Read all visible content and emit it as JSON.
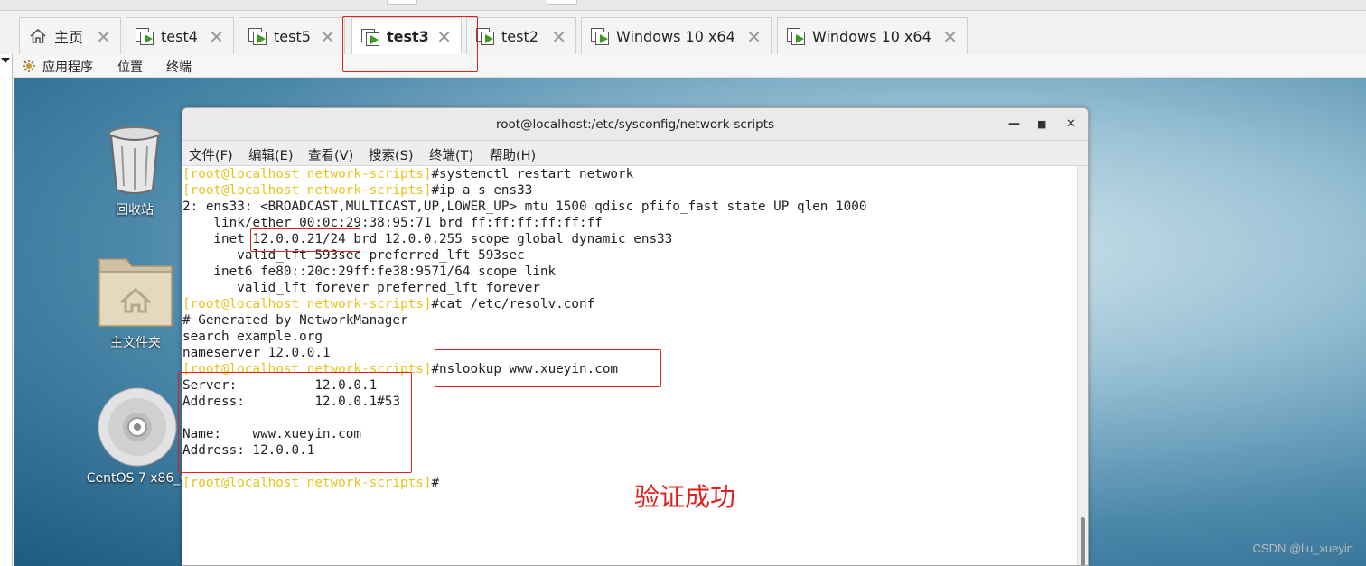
{
  "tabs": [
    {
      "label": "主页",
      "icon": "home-icon"
    },
    {
      "label": "test4",
      "icon": "vm-icon"
    },
    {
      "label": "test5",
      "icon": "vm-icon"
    },
    {
      "label": "test3",
      "icon": "vm-icon",
      "active": true
    },
    {
      "label": "test2",
      "icon": "vm-icon"
    },
    {
      "label": "Windows 10 x64",
      "icon": "vm-icon"
    },
    {
      "label": "Windows 10 x64",
      "icon": "vm-icon"
    }
  ],
  "guest_menu": {
    "apps": "应用程序",
    "places": "位置",
    "terminal": "终端"
  },
  "desktop_icons": {
    "trash": "回收站",
    "home": "主文件夹",
    "dvd": "CentOS 7 x86_6"
  },
  "terminal": {
    "title": "root@localhost:/etc/sysconfig/network-scripts",
    "menu": [
      "文件(F)",
      "编辑(E)",
      "查看(V)",
      "搜索(S)",
      "终端(T)",
      "帮助(H)"
    ],
    "prompt": "[root@localhost network-scripts]",
    "lines": [
      {
        "prompt": true,
        "text": "#systemctl restart network"
      },
      {
        "prompt": true,
        "text": "#ip a s ens33"
      },
      {
        "prompt": false,
        "text": "2: ens33: <BROADCAST,MULTICAST,UP,LOWER_UP> mtu 1500 qdisc pfifo_fast state UP qlen 1000"
      },
      {
        "prompt": false,
        "text": "    link/ether 00:0c:29:38:95:71 brd ff:ff:ff:ff:ff:ff"
      },
      {
        "prompt": false,
        "text": "    inet 12.0.0.21/24 brd 12.0.0.255 scope global dynamic ens33"
      },
      {
        "prompt": false,
        "text": "       valid_lft 593sec preferred_lft 593sec"
      },
      {
        "prompt": false,
        "text": "    inet6 fe80::20c:29ff:fe38:9571/64 scope link"
      },
      {
        "prompt": false,
        "text": "       valid_lft forever preferred_lft forever"
      },
      {
        "prompt": true,
        "text": "#cat /etc/resolv.conf"
      },
      {
        "prompt": false,
        "text": "# Generated by NetworkManager"
      },
      {
        "prompt": false,
        "text": "search example.org"
      },
      {
        "prompt": false,
        "text": "nameserver 12.0.0.1"
      },
      {
        "prompt": true,
        "text": "#nslookup www.xueyin.com"
      },
      {
        "prompt": false,
        "text": "Server:          12.0.0.1"
      },
      {
        "prompt": false,
        "text": "Address:         12.0.0.1#53"
      },
      {
        "prompt": false,
        "text": ""
      },
      {
        "prompt": false,
        "text": "Name:    www.xueyin.com"
      },
      {
        "prompt": false,
        "text": "Address: 12.0.0.1"
      },
      {
        "prompt": false,
        "text": ""
      },
      {
        "prompt": true,
        "text": "#"
      }
    ]
  },
  "annotation": "验证成功",
  "watermark": "CSDN @liu_xueyin",
  "colors": {
    "prompt": "#e8c31a",
    "annotation_red": "#e0201f",
    "vm_play": "#3a9b1f"
  }
}
